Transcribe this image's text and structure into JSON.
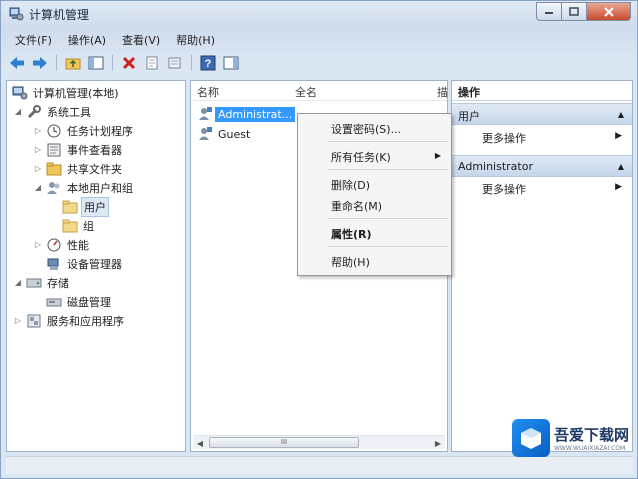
{
  "window": {
    "title": "计算机管理"
  },
  "menu": [
    "文件(F)",
    "操作(A)",
    "查看(V)",
    "帮助(H)"
  ],
  "tree": {
    "root": "计算机管理(本地)",
    "system_tools": "系统工具",
    "task_scheduler": "任务计划程序",
    "event_viewer": "事件查看器",
    "shared_folders": "共享文件夹",
    "local_users_groups": "本地用户和组",
    "users": "用户",
    "groups": "组",
    "performance": "性能",
    "device_manager": "设备管理器",
    "storage": "存储",
    "disk_management": "磁盘管理",
    "services_apps": "服务和应用程序"
  },
  "list": {
    "columns": [
      "名称",
      "全名",
      "描"
    ],
    "rows": [
      {
        "name": "Administrat...",
        "selected": true
      },
      {
        "name": "Guest",
        "selected": false
      }
    ],
    "scroll_thumb": "III"
  },
  "context_menu": {
    "set_password": "设置密码(S)...",
    "all_tasks": "所有任务(K)",
    "delete": "删除(D)",
    "rename": "重命名(M)",
    "properties": "属性(R)",
    "help": "帮助(H)"
  },
  "actions": {
    "header": "操作",
    "section1": "用户",
    "more1": "更多操作",
    "section2": "Administrator",
    "more2": "更多操作"
  },
  "watermark": {
    "title": "吾爱下载网",
    "sub": "WWW.WUAIXIAZAI.COM"
  },
  "colors": {
    "selection": "#3399ff",
    "close_button": "#c74a2c",
    "section_bg": "#c5d6ea"
  }
}
